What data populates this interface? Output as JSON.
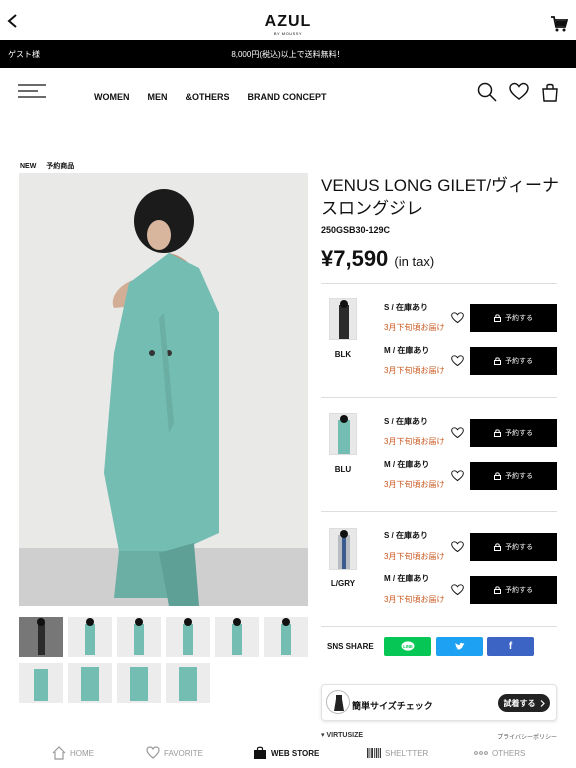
{
  "app": {
    "logo": "AZUL",
    "logo_sub": "BY MOUSSY"
  },
  "banner": {
    "guest": "ゲスト様",
    "shipping": "8,000円(税込)以上で送料無料！"
  },
  "nav": {
    "links": [
      "WOMEN",
      "MEN",
      "&OTHERS",
      "BRAND CONCEPT"
    ]
  },
  "product": {
    "badges": [
      "NEW",
      "予約商品"
    ],
    "title": "VENUS LONG GILET/ヴィーナスロングジレ",
    "code": "250GSB30-129C",
    "price": "¥7,590",
    "tax_note": "(in tax)"
  },
  "variants": [
    {
      "color": "BLK",
      "swatch": "#2b2b2b",
      "sizes": [
        {
          "size": "S / 在庫あり",
          "due": "3月下旬頃お届け",
          "button": "予約する"
        },
        {
          "size": "M / 在庫あり",
          "due": "3月下旬頃お届け",
          "button": "予約する"
        }
      ]
    },
    {
      "color": "BLU",
      "swatch": "#74bdb3",
      "sizes": [
        {
          "size": "S / 在庫あり",
          "due": "3月下旬頃お届け",
          "button": "予約する"
        },
        {
          "size": "M / 在庫あり",
          "due": "3月下旬頃お届け",
          "button": "予約する"
        }
      ]
    },
    {
      "color": "L/GRY",
      "swatch": "#b9bcc2",
      "sizes": [
        {
          "size": "S / 在庫あり",
          "due": "3月下旬頃お届け",
          "button": "予約する"
        },
        {
          "size": "M / 在庫あり",
          "due": "3月下旬頃お届け",
          "button": "予約する"
        }
      ]
    }
  ],
  "sns": {
    "label": "SNS SHARE",
    "buttons": [
      {
        "name": "line",
        "text": "LINE",
        "color": "#06c755"
      },
      {
        "name": "twitter",
        "text": "",
        "color": "#1da1f2"
      },
      {
        "name": "facebook",
        "text": "f",
        "color": "#3b64c4"
      }
    ]
  },
  "size_check": {
    "label": "簡単サイズチェック",
    "button": "試着する"
  },
  "virtusize": {
    "brand": "VIRTUSIZE",
    "privacy": "プライバシーポリシー"
  },
  "tabbar": [
    {
      "label": "HOME",
      "icon": "home-icon",
      "active": false
    },
    {
      "label": "FAVORITE",
      "icon": "heart-icon",
      "active": false
    },
    {
      "label": "WEB STORE",
      "icon": "shopping-bag-icon",
      "active": true
    },
    {
      "label": "SHEL'TTER",
      "icon": "barcode-icon",
      "active": false
    },
    {
      "label": "OTHERS",
      "icon": "more-dots-icon",
      "active": false
    }
  ],
  "colors": {
    "accent_due": "#c9571e",
    "banner_bg": "#000000",
    "product_teal": "#74bdb3"
  }
}
